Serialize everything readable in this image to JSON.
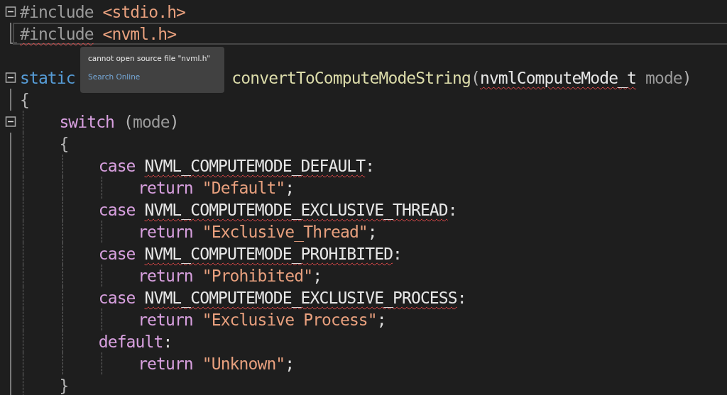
{
  "editor": {
    "lines": [
      {
        "expanded": true,
        "tokens": [
          {
            "text": "#include",
            "kind": "directive"
          },
          {
            "text": "<stdio.h>",
            "kind": "path"
          }
        ]
      },
      {
        "fold_end": true,
        "current": true,
        "tokens": [
          {
            "text": "#include",
            "kind": "directive",
            "error": true
          },
          {
            "text": "<nvml.h>",
            "kind": "path"
          }
        ]
      },
      {
        "kind": "blank"
      },
      {
        "expanded": true,
        "tokens": [
          {
            "text": "static",
            "kind": "keyword"
          },
          {
            "text": "convertToComputeModeString",
            "kind": "function",
            "covered_before": true
          },
          {
            "text": "(",
            "kind": "punct",
            "glue": true
          },
          {
            "text": "nvmlComputeMode_t",
            "kind": "type",
            "glue": true,
            "error": true
          },
          {
            "text": "mode",
            "kind": "param"
          },
          {
            "text": ")",
            "kind": "punct",
            "glue": true
          }
        ]
      },
      {
        "tokens": [
          {
            "text": "{",
            "kind": "punct"
          }
        ],
        "children": [
          {
            "expanded": true,
            "tokens": [
              {
                "text": "switch",
                "kind": "control"
              },
              {
                "text": "(",
                "kind": "punct"
              },
              {
                "text": "mode",
                "kind": "param",
                "glue": true
              },
              {
                "text": ")",
                "kind": "punct",
                "glue": true
              }
            ]
          },
          {
            "tokens": [
              {
                "text": "{",
                "kind": "punct"
              }
            ],
            "children": [
              {
                "tokens": [
                  {
                    "text": "case",
                    "kind": "control"
                  },
                  {
                    "text": "NVML_COMPUTEMODE_DEFAULT",
                    "kind": "constant",
                    "error": true
                  },
                  {
                    "text": ":",
                    "kind": "operator",
                    "glue": true
                  }
                ],
                "children": [
                  {
                    "tokens": [
                      {
                        "text": "return",
                        "kind": "control"
                      },
                      {
                        "text": "\"Default\"",
                        "kind": "string"
                      },
                      {
                        "text": ";",
                        "kind": "operator",
                        "glue": true
                      }
                    ]
                  }
                ]
              },
              {
                "tokens": [
                  {
                    "text": "case",
                    "kind": "control"
                  },
                  {
                    "text": "NVML_COMPUTEMODE_EXCLUSIVE_THREAD",
                    "kind": "constant",
                    "error": true
                  },
                  {
                    "text": ":",
                    "kind": "operator",
                    "glue": true
                  }
                ],
                "children": [
                  {
                    "tokens": [
                      {
                        "text": "return",
                        "kind": "control"
                      },
                      {
                        "text": "\"Exclusive_Thread\"",
                        "kind": "string"
                      },
                      {
                        "text": ";",
                        "kind": "operator",
                        "glue": true
                      }
                    ]
                  }
                ]
              },
              {
                "tokens": [
                  {
                    "text": "case",
                    "kind": "control"
                  },
                  {
                    "text": "NVML_COMPUTEMODE_PROHIBITED",
                    "kind": "constant",
                    "error": true
                  },
                  {
                    "text": ":",
                    "kind": "operator",
                    "glue": true
                  }
                ],
                "children": [
                  {
                    "tokens": [
                      {
                        "text": "return",
                        "kind": "control"
                      },
                      {
                        "text": "\"Prohibited\"",
                        "kind": "string"
                      },
                      {
                        "text": ";",
                        "kind": "operator",
                        "glue": true
                      }
                    ]
                  }
                ]
              },
              {
                "tokens": [
                  {
                    "text": "case",
                    "kind": "control"
                  },
                  {
                    "text": "NVML_COMPUTEMODE_EXCLUSIVE_PROCESS",
                    "kind": "constant",
                    "error": true
                  },
                  {
                    "text": ":",
                    "kind": "operator",
                    "glue": true
                  }
                ],
                "children": [
                  {
                    "tokens": [
                      {
                        "text": "return",
                        "kind": "control"
                      },
                      {
                        "text": "\"Exclusive Process\"",
                        "kind": "string"
                      },
                      {
                        "text": ";",
                        "kind": "operator",
                        "glue": true
                      }
                    ]
                  }
                ]
              },
              {
                "tokens": [
                  {
                    "text": "default",
                    "kind": "control"
                  },
                  {
                    "text": ":",
                    "kind": "operator",
                    "glue": true
                  }
                ],
                "children": [
                  {
                    "tokens": [
                      {
                        "text": "return",
                        "kind": "control"
                      },
                      {
                        "text": "\"Unknown\"",
                        "kind": "string"
                      },
                      {
                        "text": ";",
                        "kind": "operator",
                        "glue": true
                      }
                    ]
                  }
                ]
              }
            ]
          },
          {
            "tokens": [
              {
                "text": "}",
                "kind": "punct"
              }
            ]
          }
        ]
      }
    ]
  },
  "tooltip": {
    "message": "cannot open source file \"nvml.h\"",
    "link": "Search Online"
  }
}
